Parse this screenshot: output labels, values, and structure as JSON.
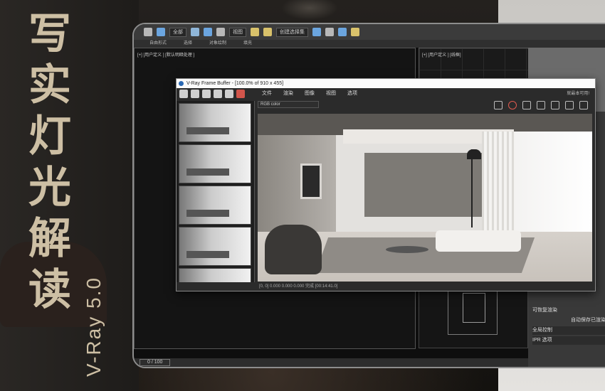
{
  "hero": {
    "title_chars": [
      "写",
      "实",
      "灯",
      "光",
      "解",
      "读"
    ],
    "subtitle": "V-Ray 5.0",
    "accent_color": "#cdbfa4"
  },
  "max": {
    "toolbar": {
      "dropdown_1": "全部",
      "dropdown_2": "视图",
      "dropdown_3": "创建选择集"
    },
    "ribbon": [
      "自由形式",
      "选择",
      "对象绘制",
      "填充"
    ],
    "left_viewport_label": "[+] [用户定义 ] [默认明暗处理 ]",
    "right_viewport_label": "[+] [用户定义 ] [线框]",
    "status": "0 / 100",
    "side_panel": {
      "row_1": "可恢复渲染",
      "row_2": "自动保存已渲染",
      "row_3": "全局控制",
      "row_4": "IPR 选项"
    }
  },
  "vfb": {
    "title": "V-Ray Frame Buffer - [100.0% of 910 x 455]",
    "menu": [
      "文件",
      "渲染",
      "图像",
      "视图",
      "选项"
    ],
    "title_right": "就最本可用!",
    "channel": "RGB color",
    "footer": "[0, 0]   0.000  0.000  0.000   完成 [00:14:41.0]",
    "history_count": 5
  }
}
